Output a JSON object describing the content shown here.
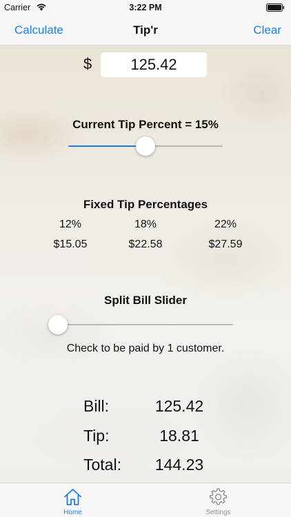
{
  "status_bar": {
    "carrier": "Carrier",
    "time": "3:22 PM"
  },
  "nav": {
    "left_button": "Calculate",
    "title": "Tip'r",
    "right_button": "Clear"
  },
  "bill": {
    "currency_symbol": "$",
    "value": "125.42"
  },
  "tip": {
    "label": "Current Tip Percent = 15%",
    "slider_fraction": 0.5
  },
  "fixed_tips": {
    "title": "Fixed Tip Percentages",
    "options": [
      {
        "percent": "12%",
        "amount": "$15.05"
      },
      {
        "percent": "18%",
        "amount": "$22.58"
      },
      {
        "percent": "22%",
        "amount": "$27.59"
      }
    ]
  },
  "split": {
    "title": "Split Bill Slider",
    "slider_fraction": 0.0,
    "caption": "Check to be paid by 1 customer."
  },
  "totals": {
    "bill_label": "Bill:",
    "bill_value": "125.42",
    "tip_label": "Tip:",
    "tip_value": "18.81",
    "total_label": "Total:",
    "total_value": "144.23"
  },
  "tabs": [
    {
      "label": "Home",
      "icon": "home-icon",
      "active": true,
      "color": "#1a7ef2"
    },
    {
      "label": "Settings",
      "icon": "gear-icon",
      "active": false,
      "color": "#8e8e93"
    }
  ]
}
